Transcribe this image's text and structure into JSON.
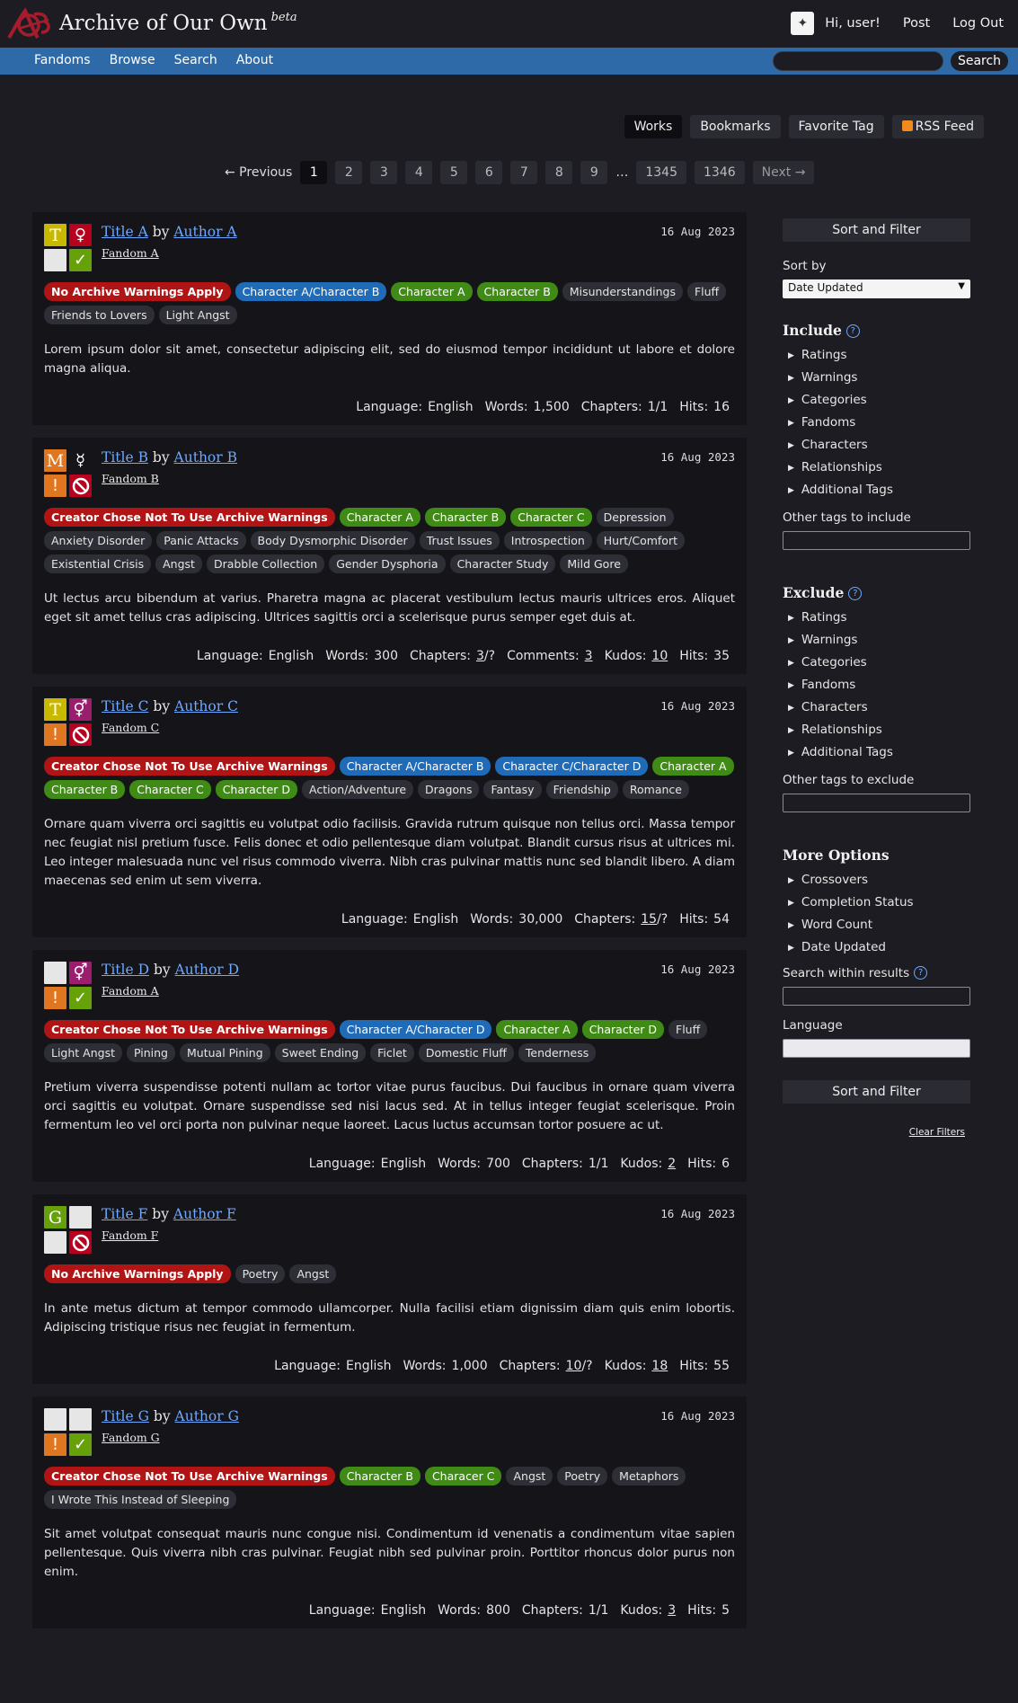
{
  "header": {
    "site_title": "Archive of Our Own",
    "beta": "beta",
    "greeting": "Hi, user!",
    "post": "Post",
    "logout": "Log Out"
  },
  "nav": {
    "items": [
      "Fandoms",
      "Browse",
      "Search",
      "About"
    ],
    "search_button": "Search",
    "search_value": ""
  },
  "actions": [
    "Works",
    "Bookmarks",
    "Favorite Tag",
    "RSS Feed"
  ],
  "pagination": {
    "previous": "← Previous",
    "pages": [
      "1",
      "2",
      "3",
      "4",
      "5",
      "6",
      "7",
      "8",
      "9"
    ],
    "ellipsis": "…",
    "last_pages": [
      "1345",
      "1346"
    ],
    "next": "Next →",
    "current": "1"
  },
  "colors": {
    "warning": "#b01414",
    "relationship": "#1f6bb8",
    "character": "#3f8b16",
    "freeform": "#2e2e36",
    "link": "#6ea8ff",
    "nav_blue": "#2f6aa8"
  },
  "works": [
    {
      "title": "Title A",
      "author": "Author A",
      "fandom": "Fandom A",
      "date": "16 Aug 2023",
      "by": "by",
      "required": [
        {
          "char": "T",
          "color": "#c9b800",
          "icon": "rating-teen-icon"
        },
        {
          "char": "♀",
          "color": "#b8001f",
          "icon": "category-ff-icon"
        },
        {
          "char": "",
          "color": "#e6e6e6",
          "icon": "warning-blank-icon"
        },
        {
          "char": "✓",
          "color": "#67a10a",
          "icon": "complete-icon"
        }
      ],
      "tags": [
        {
          "text": "No Archive Warnings Apply",
          "type": "warning"
        },
        {
          "text": "Character A/Character B",
          "type": "relationship"
        },
        {
          "text": "Character A",
          "type": "character"
        },
        {
          "text": "Character B",
          "type": "character"
        },
        {
          "text": "Misunderstandings",
          "type": "freeform"
        },
        {
          "text": "Fluff",
          "type": "freeform"
        },
        {
          "text": "Friends to Lovers",
          "type": "freeform"
        },
        {
          "text": "Light Angst",
          "type": "freeform"
        }
      ],
      "summary": "Lorem ipsum dolor sit amet, consectetur adipiscing elit, sed do eiusmod tempor incididunt ut labore et dolore magna aliqua.",
      "stats": [
        {
          "label": "Language:",
          "value": "English",
          "link": false
        },
        {
          "label": "Words:",
          "value": "1,500",
          "link": false
        },
        {
          "label": "Chapters:",
          "value": "1/1",
          "link": false
        },
        {
          "label": "Hits:",
          "value": "16",
          "link": false
        }
      ]
    },
    {
      "title": "Title B",
      "author": "Author B",
      "fandom": "Fandom B",
      "date": "16 Aug 2023",
      "by": "by",
      "required": [
        {
          "char": "M",
          "color": "#e0761f",
          "icon": "rating-mature-icon"
        },
        {
          "char": "☿",
          "color": "#141419",
          "icon": "category-other-icon"
        },
        {
          "char": "!",
          "color": "#e0761f",
          "icon": "warning-chose-not-icon"
        },
        {
          "char": "⃠",
          "color": "#b8001f",
          "icon": "incomplete-icon"
        }
      ],
      "tags": [
        {
          "text": "Creator Chose Not To Use Archive Warnings",
          "type": "warning"
        },
        {
          "text": "Character A",
          "type": "character"
        },
        {
          "text": "Character B",
          "type": "character"
        },
        {
          "text": "Character C",
          "type": "character"
        },
        {
          "text": "Depression",
          "type": "freeform"
        },
        {
          "text": "Anxiety Disorder",
          "type": "freeform"
        },
        {
          "text": "Panic Attacks",
          "type": "freeform"
        },
        {
          "text": "Body Dysmorphic Disorder",
          "type": "freeform"
        },
        {
          "text": "Trust Issues",
          "type": "freeform"
        },
        {
          "text": "Introspection",
          "type": "freeform"
        },
        {
          "text": "Hurt/Comfort",
          "type": "freeform"
        },
        {
          "text": "Existential Crisis",
          "type": "freeform"
        },
        {
          "text": "Angst",
          "type": "freeform"
        },
        {
          "text": "Drabble Collection",
          "type": "freeform"
        },
        {
          "text": "Gender Dysphoria",
          "type": "freeform"
        },
        {
          "text": "Character Study",
          "type": "freeform"
        },
        {
          "text": "Mild Gore",
          "type": "freeform"
        }
      ],
      "summary": "Ut lectus arcu bibendum at varius. Pharetra magna ac placerat vestibulum lectus mauris ultrices eros. Aliquet eget sit amet tellus cras adipiscing. Ultrices sagittis orci a scelerisque purus semper eget duis at.",
      "stats": [
        {
          "label": "Language:",
          "value": "English",
          "link": false
        },
        {
          "label": "Words:",
          "value": "300",
          "link": false
        },
        {
          "label": "Chapters:",
          "value": "3",
          "suffix": "/?",
          "link": true
        },
        {
          "label": "Comments:",
          "value": "3",
          "link": true
        },
        {
          "label": "Kudos:",
          "value": "10",
          "link": true
        },
        {
          "label": "Hits:",
          "value": "35",
          "link": false
        }
      ]
    },
    {
      "title": "Title C",
      "author": "Author C",
      "fandom": "Fandom C",
      "date": "16 Aug 2023",
      "by": "by",
      "required": [
        {
          "char": "T",
          "color": "#c9b800",
          "icon": "rating-teen-icon"
        },
        {
          "char": "⚥",
          "color": "#9b1d6d",
          "icon": "category-multi-icon"
        },
        {
          "char": "!",
          "color": "#e0761f",
          "icon": "warning-chose-not-icon"
        },
        {
          "char": "⃠",
          "color": "#b8001f",
          "icon": "incomplete-icon"
        }
      ],
      "tags": [
        {
          "text": "Creator Chose Not To Use Archive Warnings",
          "type": "warning"
        },
        {
          "text": "Character A/Character B",
          "type": "relationship"
        },
        {
          "text": "Character C/Character D",
          "type": "relationship"
        },
        {
          "text": "Character A",
          "type": "character"
        },
        {
          "text": "Character B",
          "type": "character"
        },
        {
          "text": "Character C",
          "type": "character"
        },
        {
          "text": "Character D",
          "type": "character"
        },
        {
          "text": "Action/Adventure",
          "type": "freeform"
        },
        {
          "text": "Dragons",
          "type": "freeform"
        },
        {
          "text": "Fantasy",
          "type": "freeform"
        },
        {
          "text": "Friendship",
          "type": "freeform"
        },
        {
          "text": "Romance",
          "type": "freeform"
        }
      ],
      "summary": "Ornare quam viverra orci sagittis eu volutpat odio facilisis. Gravida rutrum quisque non tellus orci. Massa tempor nec feugiat nisl pretium fusce. Felis donec et odio pellentesque diam volutpat. Blandit cursus risus at ultrices mi. Leo integer malesuada nunc vel risus commodo viverra. Nibh cras pulvinar mattis nunc sed blandit libero. A diam maecenas sed enim ut sem viverra.",
      "stats": [
        {
          "label": "Language:",
          "value": "English",
          "link": false
        },
        {
          "label": "Words:",
          "value": "30,000",
          "link": false
        },
        {
          "label": "Chapters:",
          "value": "15",
          "suffix": "/?",
          "link": true
        },
        {
          "label": "Hits:",
          "value": "54",
          "link": false
        }
      ]
    },
    {
      "title": "Title D",
      "author": "Author D",
      "fandom": "Fandom A",
      "date": "16 Aug 2023",
      "by": "by",
      "required": [
        {
          "char": "",
          "color": "#e6e6e6",
          "icon": "rating-none-icon"
        },
        {
          "char": "⚥",
          "color": "#9b1d6d",
          "icon": "category-multi-icon"
        },
        {
          "char": "!",
          "color": "#e0761f",
          "icon": "warning-chose-not-icon"
        },
        {
          "char": "✓",
          "color": "#67a10a",
          "icon": "complete-icon"
        }
      ],
      "tags": [
        {
          "text": "Creator Chose Not To Use Archive Warnings",
          "type": "warning"
        },
        {
          "text": "Character A/Character D",
          "type": "relationship"
        },
        {
          "text": "Character A",
          "type": "character"
        },
        {
          "text": "Character D",
          "type": "character"
        },
        {
          "text": "Fluff",
          "type": "freeform"
        },
        {
          "text": "Light Angst",
          "type": "freeform"
        },
        {
          "text": "Pining",
          "type": "freeform"
        },
        {
          "text": "Mutual Pining",
          "type": "freeform"
        },
        {
          "text": "Sweet Ending",
          "type": "freeform"
        },
        {
          "text": "Ficlet",
          "type": "freeform"
        },
        {
          "text": "Domestic Fluff",
          "type": "freeform"
        },
        {
          "text": "Tenderness",
          "type": "freeform"
        }
      ],
      "summary": "Pretium viverra suspendisse potenti nullam ac tortor vitae purus faucibus. Dui faucibus in ornare quam viverra orci sagittis eu volutpat. Ornare suspendisse sed nisi lacus sed. At in tellus integer feugiat scelerisque. Proin fermentum leo vel orci porta non pulvinar neque laoreet. Lacus luctus accumsan tortor posuere ac ut.",
      "stats": [
        {
          "label": "Language:",
          "value": "English",
          "link": false
        },
        {
          "label": "Words:",
          "value": "700",
          "link": false
        },
        {
          "label": "Chapters:",
          "value": "1/1",
          "link": false
        },
        {
          "label": "Kudos:",
          "value": "2",
          "link": true
        },
        {
          "label": "Hits:",
          "value": "6",
          "link": false
        }
      ]
    },
    {
      "title": "Title F",
      "author": "Author F",
      "fandom": "Fandom F",
      "date": "16 Aug 2023",
      "by": "by",
      "required": [
        {
          "char": "G",
          "color": "#67a10a",
          "icon": "rating-general-icon"
        },
        {
          "char": "",
          "color": "#e6e6e6",
          "icon": "category-none-icon"
        },
        {
          "char": "",
          "color": "#e6e6e6",
          "icon": "warning-blank-icon"
        },
        {
          "char": "⃠",
          "color": "#b8001f",
          "icon": "incomplete-icon"
        }
      ],
      "tags": [
        {
          "text": "No Archive Warnings Apply",
          "type": "warning"
        },
        {
          "text": "Poetry",
          "type": "freeform"
        },
        {
          "text": "Angst",
          "type": "freeform"
        }
      ],
      "summary": "In ante metus dictum at tempor commodo ullamcorper. Nulla facilisi etiam dignissim diam quis enim lobortis. Adipiscing tristique risus nec feugiat in fermentum.",
      "stats": [
        {
          "label": "Language:",
          "value": "English",
          "link": false
        },
        {
          "label": "Words:",
          "value": "1,000",
          "link": false
        },
        {
          "label": "Chapters:",
          "value": "10",
          "suffix": "/?",
          "link": true
        },
        {
          "label": "Kudos:",
          "value": "18",
          "link": true
        },
        {
          "label": "Hits:",
          "value": "55",
          "link": false
        }
      ]
    },
    {
      "title": "Title G",
      "author": "Author G",
      "fandom": "Fandom G",
      "date": "16 Aug 2023",
      "by": "by",
      "required": [
        {
          "char": "",
          "color": "#e6e6e6",
          "icon": "rating-none-icon"
        },
        {
          "char": "",
          "color": "#e6e6e6",
          "icon": "category-none-icon"
        },
        {
          "char": "!",
          "color": "#e0761f",
          "icon": "warning-chose-not-icon"
        },
        {
          "char": "✓",
          "color": "#67a10a",
          "icon": "complete-icon"
        }
      ],
      "tags": [
        {
          "text": "Creator Chose Not To Use Archive Warnings",
          "type": "warning"
        },
        {
          "text": "Character B",
          "type": "character"
        },
        {
          "text": "Characer C",
          "type": "character"
        },
        {
          "text": "Angst",
          "type": "freeform"
        },
        {
          "text": "Poetry",
          "type": "freeform"
        },
        {
          "text": "Metaphors",
          "type": "freeform"
        },
        {
          "text": "I Wrote This Instead of Sleeping",
          "type": "freeform"
        }
      ],
      "summary": "Sit amet volutpat consequat mauris nunc congue nisi. Condimentum id venenatis a condimentum vitae sapien pellentesque. Quis viverra nibh cras pulvinar. Feugiat nibh sed pulvinar proin. Porttitor rhoncus dolor purus non enim.",
      "stats": [
        {
          "label": "Language:",
          "value": "English",
          "link": false
        },
        {
          "label": "Words:",
          "value": "800",
          "link": false
        },
        {
          "label": "Chapters:",
          "value": "1/1",
          "link": false
        },
        {
          "label": "Kudos:",
          "value": "3",
          "link": true
        },
        {
          "label": "Hits:",
          "value": "5",
          "link": false
        }
      ]
    }
  ],
  "sidebar": {
    "sort_filter": "Sort and Filter",
    "sort_by": "Sort by",
    "sort_value": "Date Updated",
    "include": "Include",
    "include_items": [
      "Ratings",
      "Warnings",
      "Categories",
      "Fandoms",
      "Characters",
      "Relationships",
      "Additional Tags"
    ],
    "other_include": "Other tags to include",
    "exclude": "Exclude",
    "exclude_items": [
      "Ratings",
      "Warnings",
      "Categories",
      "Fandoms",
      "Characters",
      "Relationships",
      "Additional Tags"
    ],
    "other_exclude": "Other tags to exclude",
    "more_options": "More Options",
    "more_items": [
      "Crossovers",
      "Completion Status",
      "Word Count",
      "Date Updated"
    ],
    "search_within": "Search within results",
    "language": "Language",
    "sort_filter_bottom": "Sort and Filter",
    "clear_filters": "Clear Filters",
    "help": "?"
  }
}
